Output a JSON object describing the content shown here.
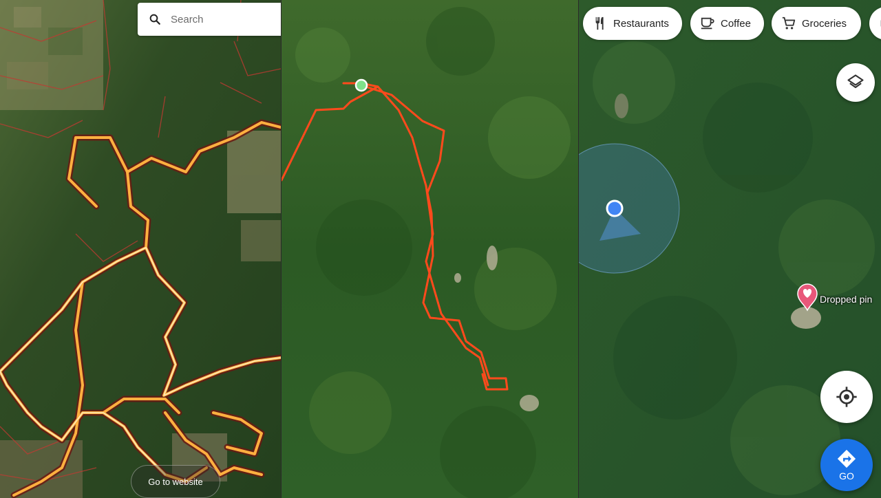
{
  "panels": {
    "left": {
      "search": {
        "placeholder": "Search",
        "icon": "search-icon"
      },
      "website_button": {
        "label": "Go to website"
      }
    },
    "middle": {
      "track_color": "#ff4a1c",
      "start_marker_color": "#7ee08a"
    },
    "right": {
      "chips": [
        {
          "label": "Restaurants",
          "icon": "fork-knife-icon"
        },
        {
          "label": "Coffee",
          "icon": "coffee-cup-icon"
        },
        {
          "label": "Groceries",
          "icon": "shopping-cart-icon"
        }
      ],
      "dropped_pin": {
        "label": "Dropped pin",
        "color": "#e8577a"
      },
      "layers_button": {
        "icon": "layers-icon"
      },
      "my_location_button": {
        "icon": "my-location-icon"
      },
      "go_button": {
        "label": "GO",
        "icon": "directions-icon",
        "color": "#1a73e8"
      },
      "location_dot_color": "#4285f4"
    }
  }
}
